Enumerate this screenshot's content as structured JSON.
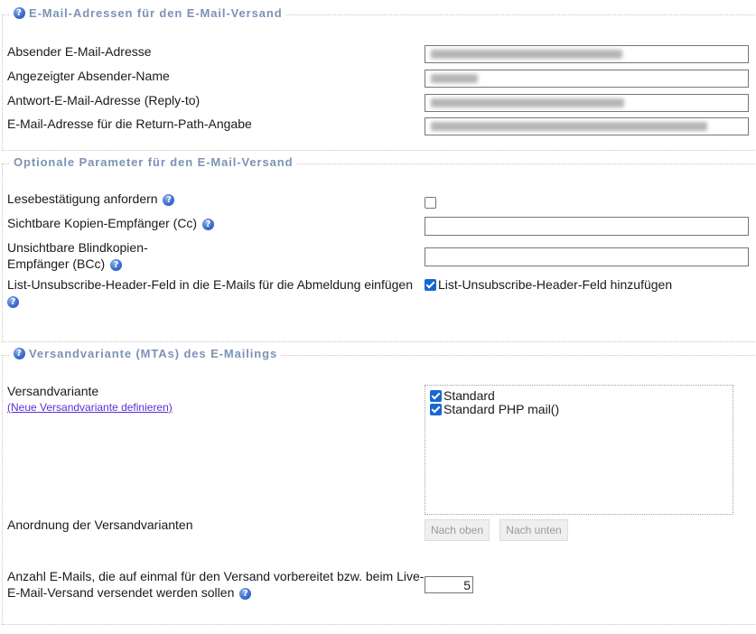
{
  "section_email": {
    "legend": "E-Mail-Adressen für den E-Mail-Versand",
    "sender_label": "Absender E-Mail-Adresse",
    "sender_name_label": "Angezeigter Absender-Name",
    "reply_to_label": "Antwort-E-Mail-Adresse (Reply-to)",
    "return_path_label": "E-Mail-Adresse für die Return-Path-Angabe"
  },
  "section_optional": {
    "legend": "Optionale Parameter für den E-Mail-Versand",
    "read_receipt_label": "Lesebestätigung anfordern",
    "read_receipt_checked": false,
    "cc_label": "Sichtbare Kopien-Empfänger (Cc)",
    "cc_value": "",
    "bcc_label_line1": "Unsichtbare Blindkopien-",
    "bcc_label_line2": "Empfänger (BCc)",
    "bcc_value": "",
    "unsubscribe_label": "List-Unsubscribe-Header-Feld in die E-Mails für die Abmeldung einfügen",
    "unsubscribe_checkbox_label": "List-Unsubscribe-Header-Feld hinzufügen",
    "unsubscribe_checked": true
  },
  "section_mta": {
    "legend": "Versandvariante (MTAs) des E-Mailings",
    "variant_label": "Versandvariante",
    "define_link": "(Neue Versandvariante definieren)",
    "variants": [
      {
        "label": "Standard",
        "checked": true
      },
      {
        "label": "Standard PHP mail()",
        "checked": true
      }
    ],
    "order_label": "Anordnung der Versandvarianten",
    "move_up_button": "Nach oben",
    "move_down_button": "Nach unten",
    "batch_label_line1": "Anzahl E-Mails, die auf einmal für den Versand vorbereitet bzw. beim Live-",
    "batch_label_line2": "E-Mail-Versand versendet werden sollen",
    "batch_value": "5"
  },
  "icons": {
    "help": "help-question-icon"
  },
  "colors": {
    "legend": "#7b93b5",
    "help_icon": "#3d6fd0",
    "link": "#5a2fd0",
    "checkbox": "#1967d2"
  }
}
